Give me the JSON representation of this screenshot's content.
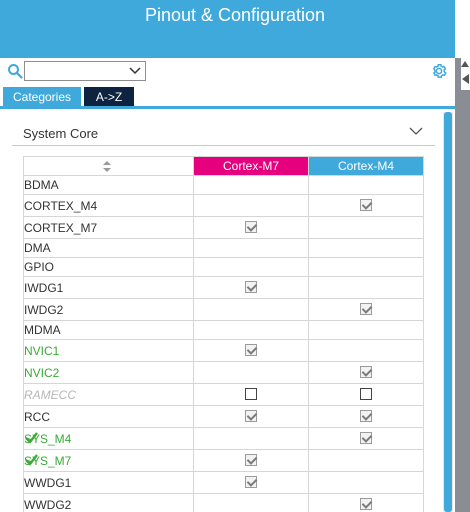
{
  "header": {
    "title": "Pinout & Configuration"
  },
  "search": {
    "value": ""
  },
  "tabs": {
    "categories": "Categories",
    "az": "A->Z"
  },
  "section": {
    "title": "System Core"
  },
  "columns": {
    "core1": "Cortex-M7",
    "core2": "Cortex-M4"
  },
  "colors": {
    "header": "#3fa9dc",
    "core1": "#e6007e",
    "core2": "#3fa9dc",
    "enabled_green": "#3aaa35"
  },
  "rows": [
    {
      "name": "BDMA",
      "m7": "",
      "m4": "",
      "style": "normal"
    },
    {
      "name": "CORTEX_M4",
      "m7": "",
      "m4": "checked",
      "style": "normal"
    },
    {
      "name": "CORTEX_M7",
      "m7": "checked",
      "m4": "",
      "style": "normal"
    },
    {
      "name": "DMA",
      "m7": "",
      "m4": "",
      "style": "normal"
    },
    {
      "name": "GPIO",
      "m7": "",
      "m4": "",
      "style": "normal"
    },
    {
      "name": "IWDG1",
      "m7": "checked",
      "m4": "",
      "style": "normal"
    },
    {
      "name": "IWDG2",
      "m7": "",
      "m4": "checked",
      "style": "normal"
    },
    {
      "name": "MDMA",
      "m7": "",
      "m4": "",
      "style": "normal"
    },
    {
      "name": "NVIC1",
      "m7": "checked",
      "m4": "",
      "style": "green"
    },
    {
      "name": "NVIC2",
      "m7": "",
      "m4": "checked",
      "style": "green"
    },
    {
      "name": "RAMECC",
      "m7": "empty",
      "m4": "empty",
      "style": "disabled"
    },
    {
      "name": "RCC",
      "m7": "checked",
      "m4": "checked",
      "style": "normal"
    },
    {
      "name": "SYS_M4",
      "m7": "",
      "m4": "checked",
      "style": "green",
      "mark": true
    },
    {
      "name": "SYS_M7",
      "m7": "checked",
      "m4": "",
      "style": "green",
      "mark": true
    },
    {
      "name": "WWDG1",
      "m7": "checked",
      "m4": "",
      "style": "normal"
    },
    {
      "name": "WWDG2",
      "m7": "",
      "m4": "checked",
      "style": "normal"
    }
  ]
}
